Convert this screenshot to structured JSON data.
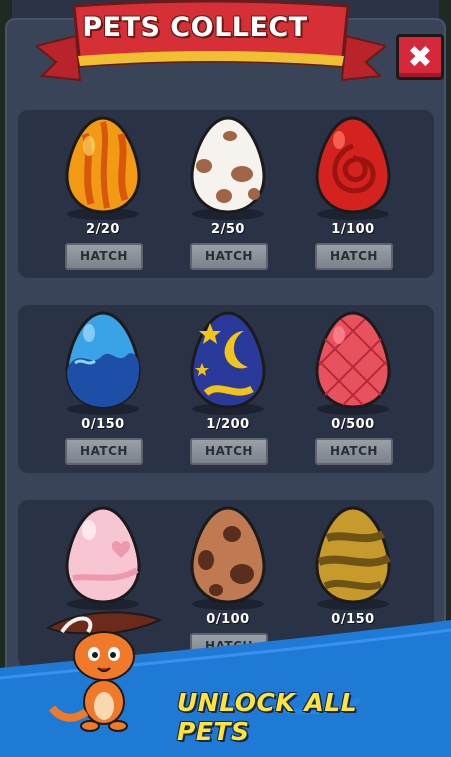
{
  "header": {
    "title": "PETS COLLECT",
    "close_label": "✖"
  },
  "eggs": [
    {
      "name": "orange-flame-egg",
      "count": "2/20",
      "hatch_label": "HATCH"
    },
    {
      "name": "spotted-egg",
      "count": "2/50",
      "hatch_label": "HATCH"
    },
    {
      "name": "red-swirl-egg",
      "count": "1/100",
      "hatch_label": "HATCH"
    },
    {
      "name": "blue-wave-egg",
      "count": "0/150",
      "hatch_label": "HATCH"
    },
    {
      "name": "moon-star-egg",
      "count": "1/200",
      "hatch_label": "HATCH"
    },
    {
      "name": "pink-scale-egg",
      "count": "0/500",
      "hatch_label": "HATCH"
    },
    {
      "name": "pink-heart-egg",
      "count": "",
      "hatch_label": ""
    },
    {
      "name": "brown-spot-egg",
      "count": "0/100",
      "hatch_label": "HATCH"
    },
    {
      "name": "gold-stripe-egg",
      "count": "0/150",
      "hatch_label": ""
    }
  ],
  "promo": {
    "text": "UNLOCK ALL PETS"
  },
  "colors": {
    "banner_red": "#d63036",
    "close_red": "#d6283a",
    "promo_blue": "#1f7ad6",
    "promo_text": "#ffe23a"
  }
}
